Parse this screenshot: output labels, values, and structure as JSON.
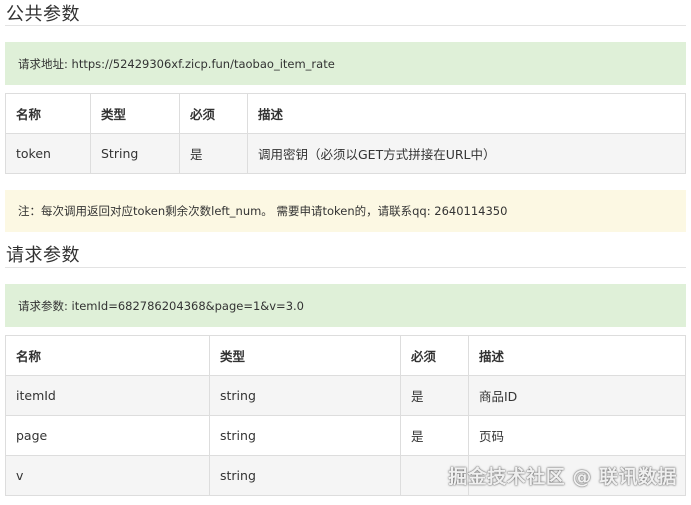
{
  "public_params": {
    "title": "公共参数",
    "endpoint_text": "请求地址: https://52429306xf.zicp.fun/taobao_item_rate",
    "headers": [
      "名称",
      "类型",
      "必须",
      "描述"
    ],
    "rows": [
      [
        "token",
        "String",
        "是",
        "调用密钥（必须以GET方式拼接在URL中）"
      ]
    ],
    "note_text": "注：每次调用返回对应token剩余次数left_num。 需要申请token的，请联系qq: 2640114350"
  },
  "request_params": {
    "title": "请求参数",
    "params_text": "请求参数: itemId=682786204368&page=1&v=3.0",
    "headers": [
      "名称",
      "类型",
      "必须",
      "描述"
    ],
    "rows": [
      [
        "itemId",
        "string",
        "是",
        "商品ID"
      ],
      [
        "page",
        "string",
        "是",
        "页码"
      ],
      [
        "v",
        "string",
        "",
        ""
      ]
    ]
  },
  "watermark_text": "掘金技术社区 @ 联讯数据",
  "colors": {
    "success_bg": "#dff0d8",
    "warning_bg": "#fcf8e3",
    "stripe_bg": "#f5f5f5",
    "border": "#dddddd"
  }
}
